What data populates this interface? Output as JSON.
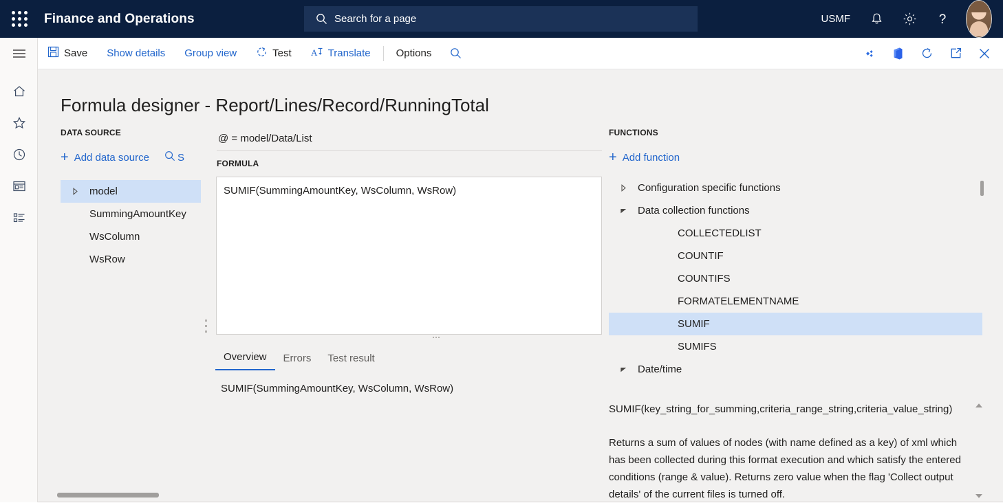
{
  "topnav": {
    "waffle_icon": "waffle-icon",
    "app_title": "Finance and Operations",
    "search": {
      "placeholder": "Search for a page",
      "icon": "search-icon"
    },
    "company": "USMF",
    "notifications_icon": "bell-icon",
    "settings_icon": "gear-icon",
    "help_icon": "question-mark-icon",
    "avatar": "user-avatar"
  },
  "rail": {
    "items": [
      {
        "icon": "hamburger-menu-icon",
        "name": "navigation-menu"
      },
      {
        "icon": "home-icon",
        "name": "home"
      },
      {
        "icon": "star-icon",
        "name": "favorites"
      },
      {
        "icon": "clock-icon",
        "name": "recent"
      },
      {
        "icon": "workspace-icon",
        "name": "workspaces"
      },
      {
        "icon": "modules-list-icon",
        "name": "modules"
      }
    ]
  },
  "commandbar": {
    "save": "Save",
    "show_details": "Show details",
    "group_view": "Group view",
    "test": "Test",
    "translate": "Translate",
    "options": "Options",
    "search_icon": "search-icon",
    "right_icons": [
      {
        "icon": "attach-to-icon",
        "name": "attach"
      },
      {
        "icon": "office-app-icon",
        "name": "open-in-office"
      },
      {
        "icon": "refresh-icon",
        "name": "refresh"
      },
      {
        "icon": "open-in-new-window-icon",
        "name": "popout"
      },
      {
        "icon": "close-icon",
        "name": "close"
      }
    ]
  },
  "page": {
    "title": "Formula designer - Report/Lines/Record/RunningTotal",
    "datasource": {
      "label": "DATA SOURCE",
      "add_label": "Add data source",
      "search_label": "S",
      "search_icon": "search-icon",
      "tree": [
        {
          "label": "model",
          "expander": "collapsed",
          "indent": 0,
          "selected": true
        },
        {
          "label": "SummingAmountKey",
          "expander": "none",
          "indent": 1,
          "selected": false
        },
        {
          "label": "WsColumn",
          "expander": "none",
          "indent": 1,
          "selected": false
        },
        {
          "label": "WsRow",
          "expander": "none",
          "indent": 1,
          "selected": false
        }
      ]
    },
    "formula": {
      "binding": "@ = model/Data/List",
      "label": "FORMULA",
      "value": "SUMIF(SummingAmountKey, WsColumn, WsRow)",
      "tabs": [
        {
          "label": "Overview",
          "active": true
        },
        {
          "label": "Errors",
          "active": false
        },
        {
          "label": "Test result",
          "active": false
        }
      ],
      "overview_text": "SUMIF(SummingAmountKey, WsColumn, WsRow)"
    },
    "functions": {
      "label": "FUNCTIONS",
      "add_label": "Add function",
      "tree": [
        {
          "label": "Configuration specific functions",
          "expander": "collapsed",
          "leaf": false,
          "selected": false
        },
        {
          "label": "Data collection functions",
          "expander": "expanded",
          "leaf": false,
          "selected": false
        },
        {
          "label": "COLLECTEDLIST",
          "expander": "none",
          "leaf": true,
          "selected": false
        },
        {
          "label": "COUNTIF",
          "expander": "none",
          "leaf": true,
          "selected": false
        },
        {
          "label": "COUNTIFS",
          "expander": "none",
          "leaf": true,
          "selected": false
        },
        {
          "label": "FORMATELEMENTNAME",
          "expander": "none",
          "leaf": true,
          "selected": false
        },
        {
          "label": "SUMIF",
          "expander": "none",
          "leaf": true,
          "selected": true
        },
        {
          "label": "SUMIFS",
          "expander": "none",
          "leaf": true,
          "selected": false
        },
        {
          "label": "Date/time",
          "expander": "expanded",
          "leaf": false,
          "selected": false
        }
      ],
      "description_signature": "SUMIF(key_string_for_summing,criteria_range_string,criteria_value_string)",
      "description_body": "Returns a sum of values of nodes (with name defined as a key) of xml which has been collected during this format execution and which satisfy the entered conditions (range & value). Returns zero value when the flag 'Collect output details' of the current files is turned off."
    }
  },
  "colors": {
    "navbar": "#0b1f3f",
    "accent_link": "#2266cc",
    "selection": "#cfe0f7",
    "page_background": "#f2f1f0"
  }
}
